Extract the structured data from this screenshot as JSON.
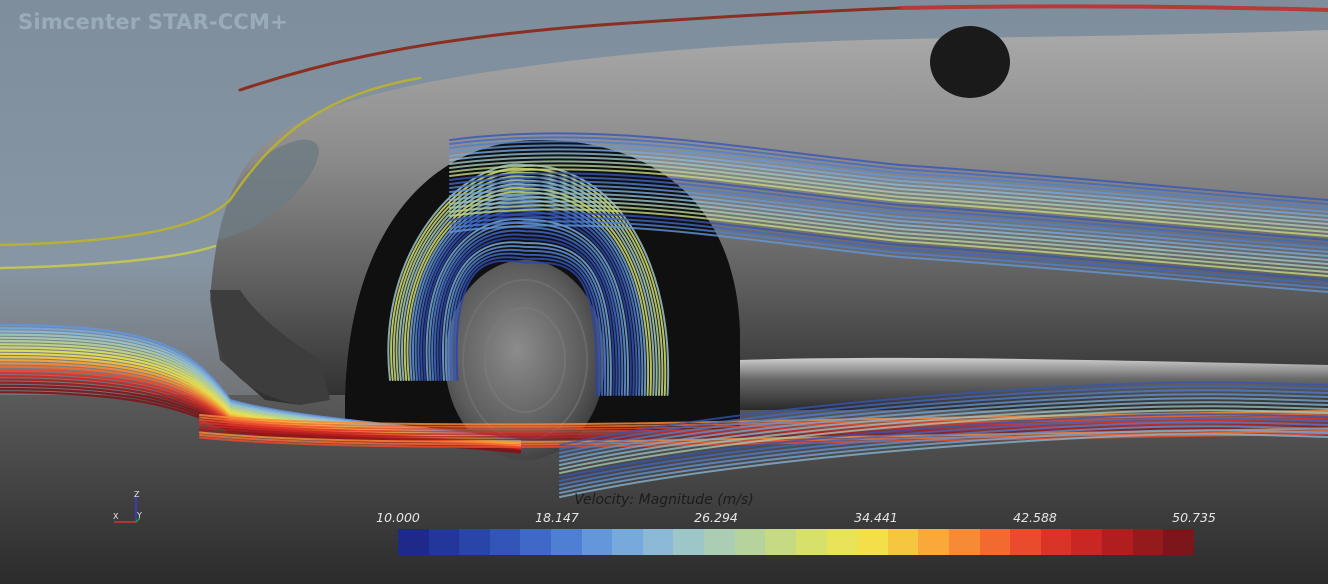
{
  "app": {
    "title": "Simcenter STAR-CCM+"
  },
  "axes_triad": {
    "labels": [
      "Z",
      "X",
      "Y"
    ]
  },
  "legend": {
    "title": "Velocity: Magnitude (m/s)",
    "ticks": [
      "10.000",
      "18.147",
      "26.294",
      "34.441",
      "42.588",
      "50.735"
    ],
    "colors": [
      "#1d2a8a",
      "#23369a",
      "#2a45a8",
      "#3455b8",
      "#4068c6",
      "#4f7fd2",
      "#6396da",
      "#78a9dc",
      "#8cbad6",
      "#9dc6c8",
      "#aacdb4",
      "#b6d39b",
      "#c6da82",
      "#d8e06c",
      "#e8e45a",
      "#f2df4a",
      "#f6c640",
      "#f8a93a",
      "#f78a35",
      "#f36a31",
      "#ea4b2c",
      "#dc3329",
      "#c92724",
      "#b01e1f",
      "#951a1c",
      "#7c161b"
    ]
  },
  "colors": {
    "slow": "#24347f",
    "fast": "#c4261f"
  }
}
